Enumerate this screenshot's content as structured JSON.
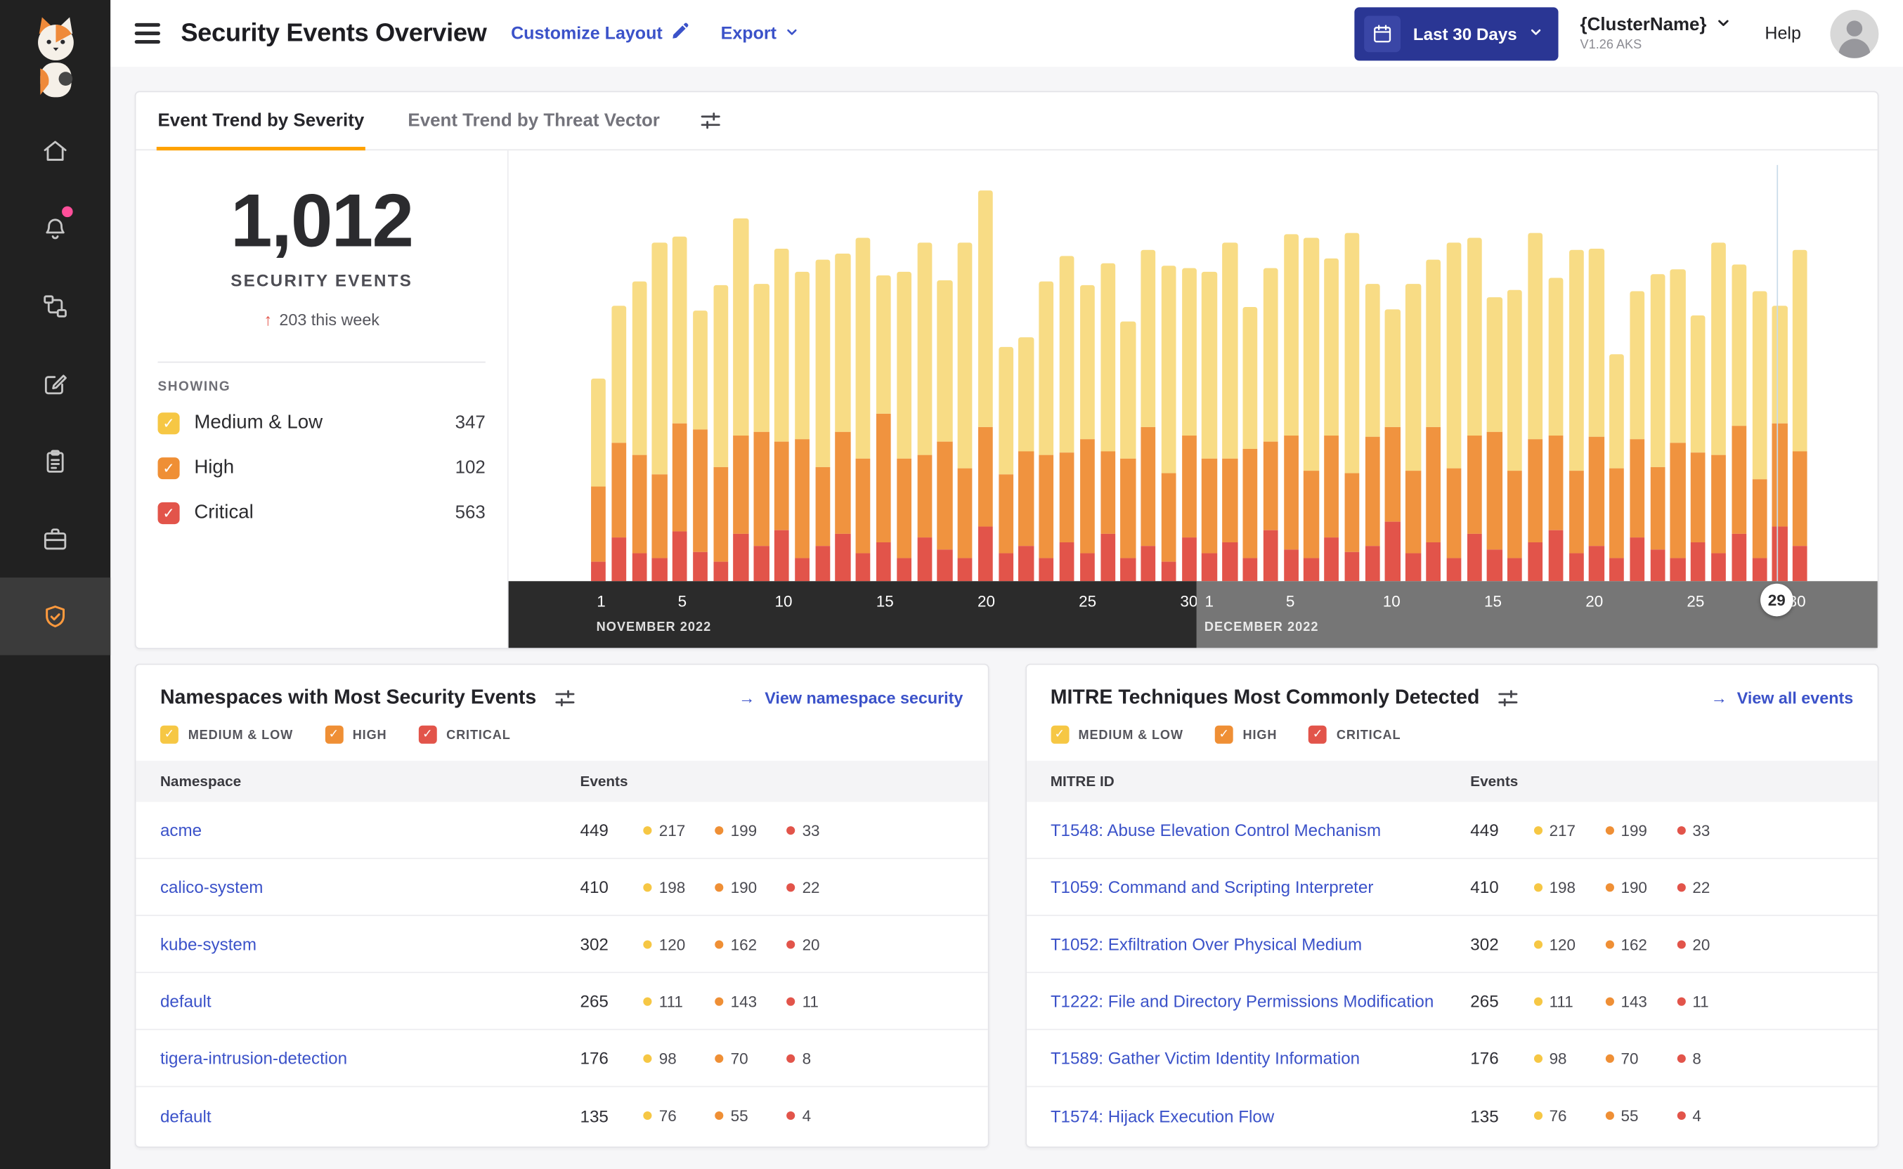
{
  "theme": {
    "accent_orange": "#ffa200",
    "link_blue": "#3b52c9",
    "sidebar_bg": "#212121",
    "sidebar_active_bg": "#3b3b3b",
    "date_button_bg": "#2a3694",
    "notification_dot": "#ff4f9a",
    "axis_november_bg": "#2b2b2b",
    "axis_december_bg": "#767676"
  },
  "glyphs": {
    "check": "✓",
    "up_arrow": "↑",
    "right_arrow": "→"
  },
  "sidebar": {
    "items": [
      {
        "id": "home",
        "icon": "home-icon"
      },
      {
        "id": "alerts",
        "icon": "bell-icon",
        "badge": true
      },
      {
        "id": "service-graph",
        "icon": "graph-icon"
      },
      {
        "id": "policies",
        "icon": "edit-square-icon"
      },
      {
        "id": "compliance",
        "icon": "clipboard-icon"
      },
      {
        "id": "workloads",
        "icon": "briefcase-icon"
      },
      {
        "id": "security-events",
        "icon": "shield-icon",
        "active": true
      }
    ]
  },
  "header": {
    "title": "Security Events Overview",
    "customize_label": "Customize Layout",
    "export_label": "Export",
    "date_range_label": "Last 30 Days",
    "cluster_name": "{ClusterName}",
    "cluster_version": "V1.26 AKS",
    "help_label": "Help"
  },
  "severities": [
    {
      "id": "medium-low",
      "label": "Medium & Low",
      "color": "#f6c744"
    },
    {
      "id": "high",
      "label": "High",
      "color": "#ef8f35"
    },
    {
      "id": "critical",
      "label": "Critical",
      "color": "#e2544a"
    }
  ],
  "trend_card": {
    "tabs": [
      {
        "label": "Event Trend by Severity",
        "active": true
      },
      {
        "label": "Event Trend by Threat Vector",
        "active": false
      }
    ],
    "total": "1,012",
    "total_label": "SECURITY EVENTS",
    "delta_text": "203 this week",
    "showing_label": "SHOWING",
    "legend_counts": [
      347,
      102,
      563
    ]
  },
  "chart_data": {
    "type": "bar",
    "stacked": true,
    "title": "Event Trend by Severity",
    "xlabel": "",
    "ylabel": "",
    "ylim": [
      0,
      205
    ],
    "grid": false,
    "legend_position": "left",
    "months": [
      {
        "label": "NOVEMBER 2022",
        "days": 30,
        "ticks": [
          1,
          5,
          10,
          15,
          20,
          25,
          30
        ],
        "band_color": "#2b2b2b"
      },
      {
        "label": "DECEMBER 2022",
        "days": 30,
        "ticks": [
          1,
          5,
          10,
          15,
          20,
          25,
          30
        ],
        "band_color": "#767676"
      }
    ],
    "selected": {
      "month_index": 1,
      "day": 29
    },
    "series": [
      {
        "name": "Medium & Low",
        "color": "#f8dc85",
        "values": [
          55,
          70,
          88,
          118,
          95,
          60,
          92,
          110,
          75,
          98,
          85,
          105,
          90,
          112,
          70,
          95,
          108,
          82,
          115,
          120,
          65,
          58,
          88,
          100,
          78,
          95,
          70,
          90,
          105,
          85,
          95,
          110,
          72,
          88,
          102,
          118,
          90,
          122,
          78,
          60,
          95,
          85,
          115,
          100,
          68,
          92,
          105,
          80,
          112,
          96,
          58,
          75,
          98,
          88,
          70,
          108,
          82,
          95,
          60,
          102
        ]
      },
      {
        "name": "High",
        "color": "#f0933f",
        "values": [
          38,
          48,
          50,
          42,
          55,
          62,
          48,
          50,
          58,
          45,
          60,
          40,
          52,
          48,
          65,
          50,
          42,
          55,
          45,
          50,
          40,
          48,
          52,
          45,
          58,
          42,
          50,
          60,
          45,
          52,
          48,
          42,
          55,
          45,
          58,
          44,
          52,
          40,
          55,
          48,
          42,
          58,
          45,
          50,
          60,
          44,
          52,
          48,
          42,
          55,
          45,
          50,
          42,
          58,
          45,
          50,
          55,
          40,
          52,
          48
        ]
      },
      {
        "name": "Critical",
        "color": "#e2544a",
        "values": [
          10,
          22,
          14,
          12,
          25,
          15,
          10,
          24,
          18,
          26,
          12,
          18,
          24,
          14,
          20,
          12,
          22,
          16,
          12,
          28,
          14,
          18,
          12,
          20,
          14,
          24,
          12,
          18,
          10,
          22,
          14,
          20,
          12,
          26,
          16,
          12,
          22,
          15,
          18,
          30,
          14,
          20,
          12,
          24,
          16,
          12,
          20,
          26,
          14,
          18,
          12,
          22,
          16,
          12,
          20,
          14,
          24,
          12,
          28,
          18
        ]
      }
    ]
  },
  "namespaces_card": {
    "title": "Namespaces with Most Security Events",
    "action_label": "View namespace security",
    "columns": [
      "Namespace",
      "Events"
    ],
    "rows": [
      {
        "name": "acme",
        "events": 449,
        "by_severity": [
          217,
          199,
          33
        ]
      },
      {
        "name": "calico-system",
        "events": 410,
        "by_severity": [
          198,
          190,
          22
        ]
      },
      {
        "name": "kube-system",
        "events": 302,
        "by_severity": [
          120,
          162,
          20
        ]
      },
      {
        "name": "default",
        "events": 265,
        "by_severity": [
          111,
          143,
          11
        ]
      },
      {
        "name": "tigera-intrusion-detection",
        "events": 176,
        "by_severity": [
          98,
          70,
          8
        ]
      },
      {
        "name": "default",
        "events": 135,
        "by_severity": [
          76,
          55,
          4
        ]
      }
    ]
  },
  "mitre_card": {
    "title": "MITRE Techniques Most Commonly Detected",
    "action_label": "View all events",
    "columns": [
      "MITRE ID",
      "Events"
    ],
    "rows": [
      {
        "name": "T1548: Abuse Elevation Control Mechanism",
        "events": 449,
        "by_severity": [
          217,
          199,
          33
        ]
      },
      {
        "name": "T1059: Command and Scripting Interpreter",
        "events": 410,
        "by_severity": [
          198,
          190,
          22
        ]
      },
      {
        "name": "T1052: Exfiltration Over Physical Medium",
        "events": 302,
        "by_severity": [
          120,
          162,
          20
        ]
      },
      {
        "name": "T1222: File and Directory Permissions Modification",
        "events": 265,
        "by_severity": [
          111,
          143,
          11
        ]
      },
      {
        "name": "T1589: Gather Victim Identity Information",
        "events": 176,
        "by_severity": [
          98,
          70,
          8
        ]
      },
      {
        "name": "T1574: Hijack Execution Flow",
        "events": 135,
        "by_severity": [
          76,
          55,
          4
        ]
      }
    ]
  }
}
